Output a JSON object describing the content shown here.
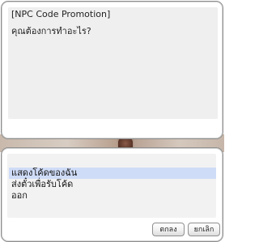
{
  "npc_dialog": {
    "title_line": "[NPC Code Promotion]",
    "question_line": "คุณต้องการทำอะไร?"
  },
  "menu": {
    "items": [
      {
        "label": "แสดงโค้ดของฉัน",
        "selected": true
      },
      {
        "label": "ส่งตั๋วเพื่อรับโค้ด",
        "selected": false
      },
      {
        "label": "ออก",
        "selected": false
      }
    ],
    "ok_label": "ตกลง",
    "cancel_label": "ยกเลิก"
  },
  "colors": {
    "selection_highlight": "#cfdcf7",
    "panel_background": "#efefef",
    "window_border": "#8e8e8e"
  }
}
